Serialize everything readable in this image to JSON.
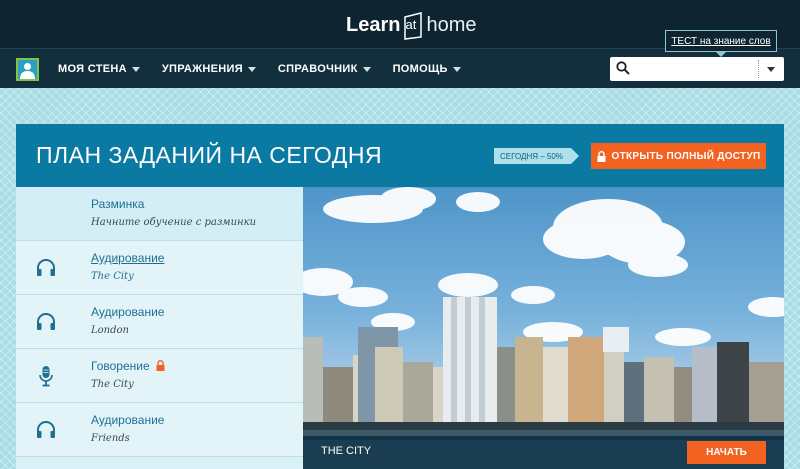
{
  "logo": {
    "part1": "Learn",
    "part2": "at",
    "part3": "home"
  },
  "test_link": "ТЕСТ на знание слов",
  "nav": {
    "items": [
      {
        "label": "МОЯ СТЕНА"
      },
      {
        "label": "УПРАЖНЕНИЯ"
      },
      {
        "label": "СПРАВОЧНИК"
      },
      {
        "label": "ПОМОЩЬ"
      }
    ]
  },
  "search": {
    "value": "",
    "placeholder": ""
  },
  "panel": {
    "title": "ПЛАН ЗАДАНИЙ НА СЕГОДНЯ",
    "badge": "СЕГОДНЯ – 50%",
    "progress_percent": 50,
    "access_button": "ОТКРЫТЬ ПОЛНЫЙ ДОСТУП"
  },
  "tasks": [
    {
      "title": "Разминка",
      "subtitle": "Начните обучение с разминки",
      "icon": "none",
      "locked": false
    },
    {
      "title": "Аудирование",
      "subtitle": "The City",
      "icon": "headphones-icon",
      "locked": false,
      "active": true
    },
    {
      "title": "Аудирование",
      "subtitle": "London",
      "icon": "headphones-icon",
      "locked": false
    },
    {
      "title": "Говорение",
      "subtitle": "The City",
      "icon": "microphone-icon",
      "locked": true
    },
    {
      "title": "Аудирование",
      "subtitle": "Friends",
      "icon": "headphones-icon",
      "locked": false
    }
  ],
  "preview": {
    "caption": "THE CITY",
    "start_button": "НАЧАТЬ"
  },
  "colors": {
    "brand_dark": "#0e2431",
    "nav": "#132f3e",
    "header_blue": "#0b7aa3",
    "accent_orange": "#f26322",
    "link_blue": "#1f6f93"
  }
}
